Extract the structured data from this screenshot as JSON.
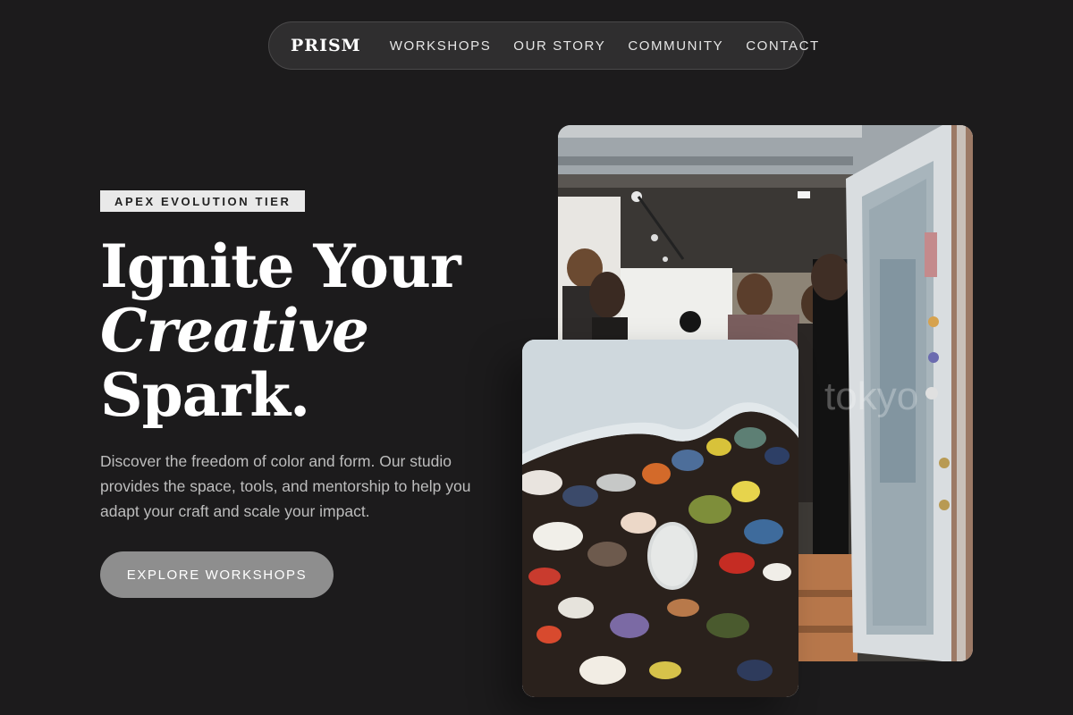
{
  "nav": {
    "brand": "PRISM",
    "links": [
      "WORKSHOPS",
      "OUR STORY",
      "COMMUNITY",
      "CONTACT"
    ]
  },
  "hero": {
    "badge": "APEX EVOLUTION TIER",
    "headline_1": "Ignite Your",
    "headline_2": "Creative",
    "headline_3": "Spark.",
    "lead": "Discover the freedom of color and form. Our studio provides the space, tools, and mentorship to help you adapt your craft and scale your impact.",
    "cta": "EXPLORE WORKSHOPS"
  },
  "images": {
    "gallery_alt": "gallery-opening-photo",
    "palette_alt": "paint-palette-photo",
    "gallery_watermark": "tokyo"
  },
  "colors": {
    "background": "#1c1b1c",
    "nav_bg": "#2f2e2f",
    "badge_bg": "#e9e9e9",
    "cta_bg": "#8e8e8e"
  }
}
